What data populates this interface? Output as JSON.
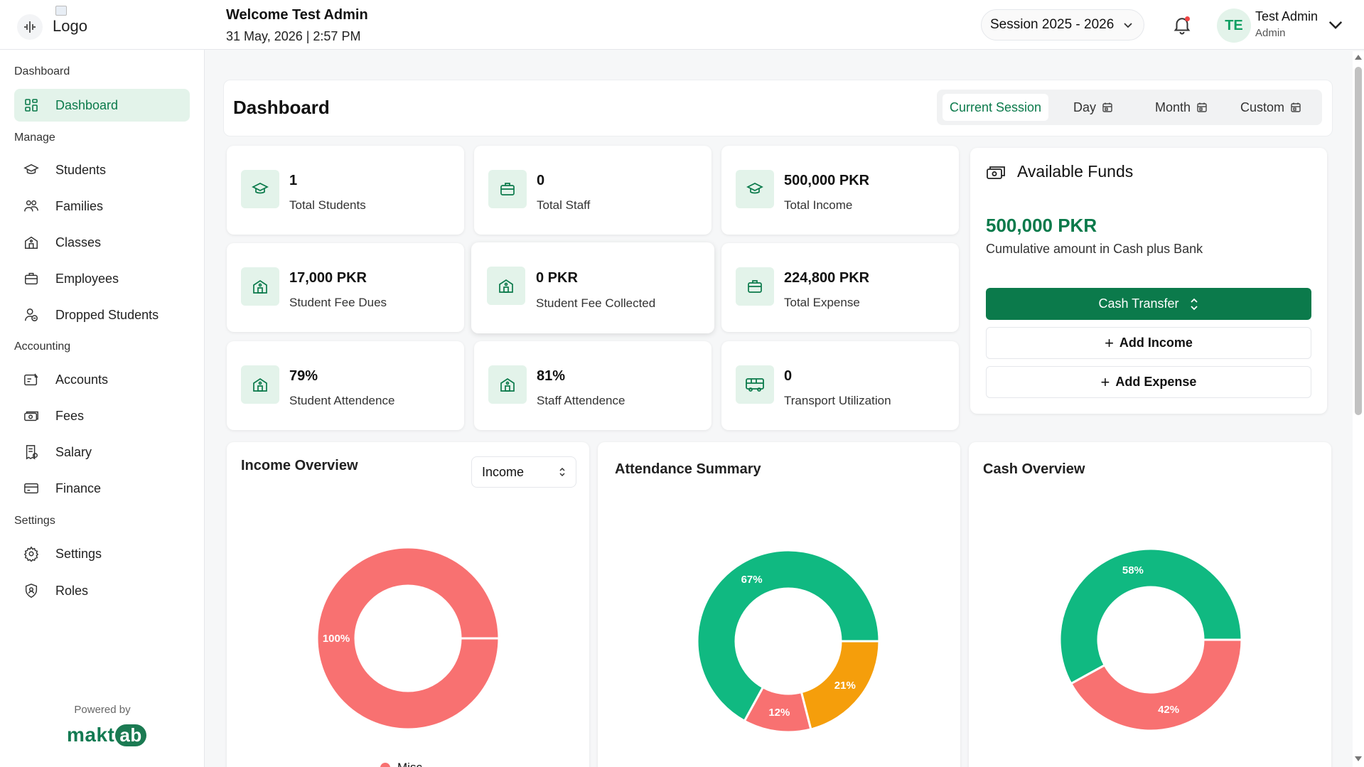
{
  "header": {
    "logo_alt": "Logo",
    "welcome": "Welcome Test Admin",
    "datetime": "31 May, 2026 | 2:57 PM",
    "session": "Session 2025 - 2026",
    "avatar_initials": "TE",
    "user_name": "Test Admin",
    "user_role": "Admin"
  },
  "sidebar": {
    "sections": [
      {
        "label": "Dashboard",
        "items": [
          {
            "label": "Dashboard",
            "icon": "grid-icon",
            "active": true
          }
        ]
      },
      {
        "label": "Manage",
        "items": [
          {
            "label": "Students",
            "icon": "graduation-cap-icon"
          },
          {
            "label": "Families",
            "icon": "users-icon"
          },
          {
            "label": "Classes",
            "icon": "school-icon"
          },
          {
            "label": "Employees",
            "icon": "briefcase-icon"
          },
          {
            "label": "Dropped Students",
            "icon": "user-minus-icon"
          }
        ]
      },
      {
        "label": "Accounting",
        "items": [
          {
            "label": "Accounts",
            "icon": "ledger-icon"
          },
          {
            "label": "Fees",
            "icon": "banknote-icon"
          },
          {
            "label": "Salary",
            "icon": "receipt-icon"
          },
          {
            "label": "Finance",
            "icon": "credit-card-icon"
          }
        ]
      },
      {
        "label": "Settings",
        "items": [
          {
            "label": "Settings",
            "icon": "gear-icon"
          },
          {
            "label": "Roles",
            "icon": "shield-user-icon"
          }
        ]
      }
    ],
    "powered_by": "Powered by",
    "brand_a": "makt",
    "brand_b": "ab"
  },
  "dashboard": {
    "title": "Dashboard",
    "filters": [
      {
        "label": "Current Session",
        "active": true
      },
      {
        "label": "Day"
      },
      {
        "label": "Month"
      },
      {
        "label": "Custom"
      }
    ]
  },
  "stats": [
    {
      "value": "1",
      "label": "Total Students",
      "icon": "graduation-cap-icon"
    },
    {
      "value": "0",
      "label": "Total Staff",
      "icon": "briefcase-icon"
    },
    {
      "value": "500,000 PKR",
      "label": "Total Income",
      "icon": "graduation-cap-icon"
    },
    {
      "value": "17,000 PKR",
      "label": "Student Fee Dues",
      "icon": "school-icon"
    },
    {
      "value": "0 PKR",
      "label": "Student Fee Collected",
      "icon": "school-icon"
    },
    {
      "value": "224,800 PKR",
      "label": "Total Expense",
      "icon": "briefcase-icon"
    },
    {
      "value": "79%",
      "label": "Student Attendence",
      "icon": "school-icon"
    },
    {
      "value": "81%",
      "label": "Staff Attendence",
      "icon": "school-icon"
    },
    {
      "value": "0",
      "label": "Transport Utilization",
      "icon": "bus-icon"
    }
  ],
  "funds": {
    "title": "Available Funds",
    "amount": "500,000 PKR",
    "description": "Cumulative amount in Cash plus Bank",
    "cash_transfer": "Cash Transfer",
    "add_income": "Add Income",
    "add_expense": "Add Expense"
  },
  "panels": {
    "income_title": "Income Overview",
    "income_select": "Income",
    "attendance_title": "Attendance Summary",
    "cash_title": "Cash Overview",
    "income_legend": "Misc"
  },
  "colors": {
    "green": "#10b981",
    "red": "#f87171",
    "orange": "#f59e0b",
    "brand": "#0b7a4b"
  },
  "chart_data": [
    {
      "type": "pie",
      "title": "Income Overview",
      "slices": [
        {
          "name": "Misc",
          "value": 100,
          "label": "100%",
          "color": "#f87171"
        }
      ]
    },
    {
      "type": "pie",
      "title": "Attendance Summary",
      "slices": [
        {
          "value": 67,
          "label": "67%",
          "color": "#10b981"
        },
        {
          "value": 21,
          "label": "21%",
          "color": "#f59e0b"
        },
        {
          "value": 12,
          "label": "12%",
          "color": "#f87171"
        }
      ]
    },
    {
      "type": "pie",
      "title": "Cash Overview",
      "slices": [
        {
          "value": 58,
          "label": "58%",
          "color": "#10b981"
        },
        {
          "value": 42,
          "label": "42%",
          "color": "#f87171"
        }
      ]
    }
  ]
}
